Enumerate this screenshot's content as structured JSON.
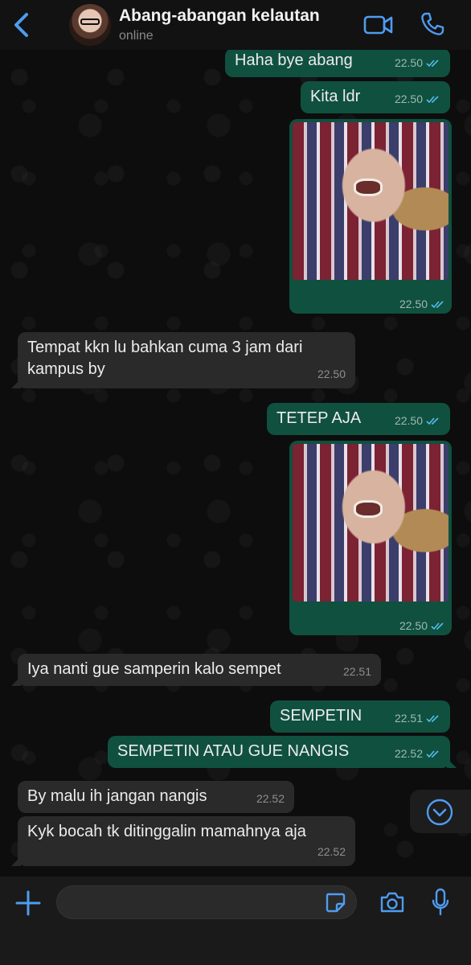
{
  "header": {
    "contact_name": "Abang-abangan kelautan",
    "status": "online",
    "icons": [
      "back-chevron-icon",
      "video-call-icon",
      "phone-icon"
    ]
  },
  "messages": [
    {
      "dir": "out",
      "text": "Haha bye abang",
      "time": "22.50",
      "read": true
    },
    {
      "dir": "out",
      "text": "Kita ldr",
      "time": "22.50",
      "read": true
    },
    {
      "dir": "out",
      "type": "photo",
      "time": "22.50",
      "read": true
    },
    {
      "dir": "in",
      "text": "Tempat kkn lu bahkan cuma 3 jam dari kampus by",
      "time": "22.50"
    },
    {
      "dir": "out",
      "text": "TETEP AJA",
      "time": "22.50",
      "read": true
    },
    {
      "dir": "out",
      "type": "photo",
      "time": "22.50",
      "read": true
    },
    {
      "dir": "in",
      "text": "Iya nanti gue samperin kalo sempet",
      "time": "22.51"
    },
    {
      "dir": "out",
      "text": "SEMPETIN",
      "time": "22.51",
      "read": true
    },
    {
      "dir": "out",
      "text": "SEMPETIN ATAU GUE NANGIS",
      "time": "22.52",
      "read": true
    },
    {
      "dir": "in",
      "text": "By malu ih jangan nangis",
      "time": "22.52"
    },
    {
      "dir": "in",
      "text": "Kyk bocah tk ditinggalin mamahnya aja",
      "time": "22.52"
    }
  ],
  "input": {
    "placeholder": "",
    "icons": [
      "plus-icon",
      "sticker-icon",
      "camera-icon",
      "mic-icon"
    ]
  },
  "colors": {
    "accent": "#4f9cf0",
    "outgoing_bubble": "#10503f",
    "incoming_bubble": "#2a2a2a",
    "read_ticks": "#53bdeb"
  }
}
